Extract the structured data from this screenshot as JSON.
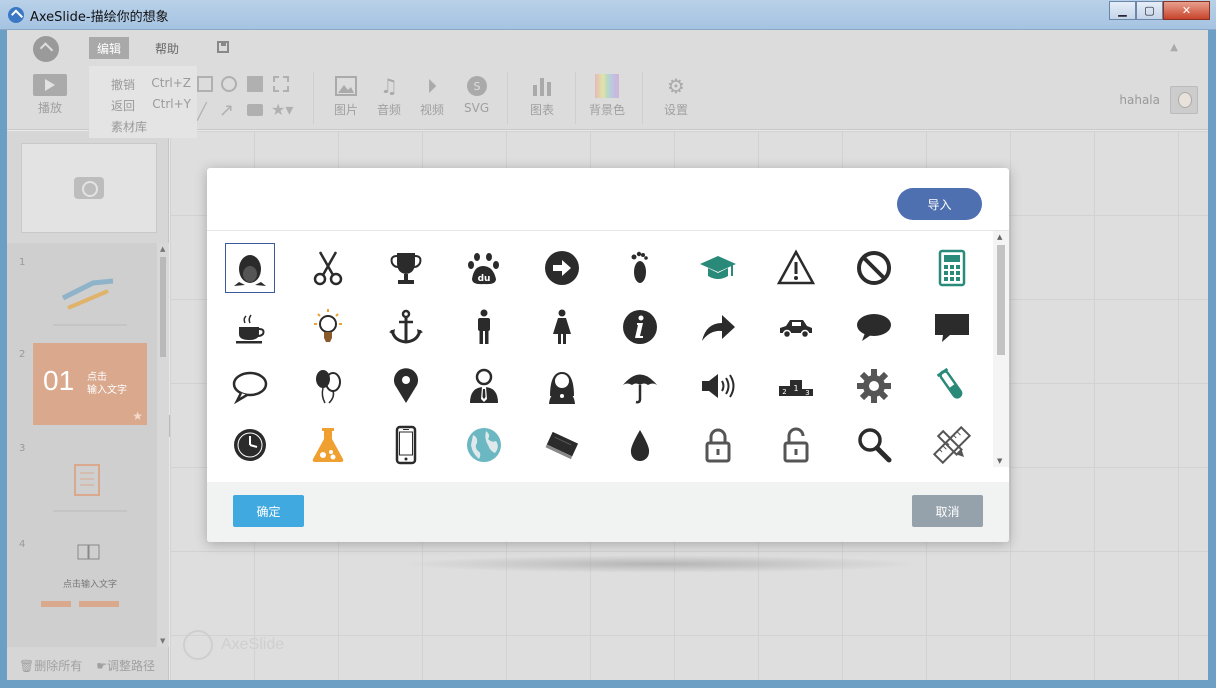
{
  "window": {
    "title": "AxeSlide-描绘你的想象"
  },
  "menubar": {
    "edit": "编辑",
    "help": "帮助"
  },
  "edit_menu": {
    "undo": "撤销",
    "undo_key": "Ctrl+Z",
    "redo": "返回",
    "redo_key": "Ctrl+Y",
    "library": "素材库"
  },
  "toolbar": {
    "play": "播放",
    "image": "图片",
    "audio": "音频",
    "video": "视频",
    "svg": "SVG",
    "chart": "图表",
    "bgcolor": "背景色",
    "settings": "设置"
  },
  "user": {
    "name": "hahala"
  },
  "slides": [
    {
      "num": "1"
    },
    {
      "num": "2",
      "big": "01",
      "text1": "点击",
      "text2": "输入文字"
    },
    {
      "num": "3"
    },
    {
      "num": "4",
      "text": "点击输入文字"
    }
  ],
  "leftfoot": {
    "delete_all": "删除所有",
    "adjust_path": "调整路径"
  },
  "watermark": "AxeSlide",
  "dialog": {
    "import": "导入",
    "ok": "确定",
    "cancel": "取消",
    "icons": [
      "qq-penguin-icon",
      "scissors-icon",
      "trophy-icon",
      "baidu-paw-icon",
      "arrow-circle-icon",
      "footprint-icon",
      "graduation-cap-icon",
      "warning-icon",
      "no-entry-icon",
      "calculator-icon",
      "coffee-cup-icon",
      "lightbulb-icon",
      "anchor-icon",
      "man-icon",
      "woman-icon",
      "info-icon",
      "share-arrow-icon",
      "car-icon",
      "speech-bubble-icon",
      "comment-box-icon",
      "speech-outline-icon",
      "balloons-icon",
      "map-pin-icon",
      "businessman-icon",
      "girl-icon",
      "umbrella-icon",
      "speaker-icon",
      "podium-icon",
      "gear-icon",
      "test-tube-icon",
      "clock-icon",
      "flask-icon",
      "mobile-phone-icon",
      "globe-icon",
      "book-icon",
      "drop-icon",
      "lock-icon",
      "unlock-icon",
      "magnifier-icon",
      "ruler-pencil-icon"
    ],
    "colors": {
      "dark": "#2b2b2b",
      "teal": "#2a8a7a",
      "orange": "#f0a030",
      "blue": "#4e6fb0"
    }
  }
}
